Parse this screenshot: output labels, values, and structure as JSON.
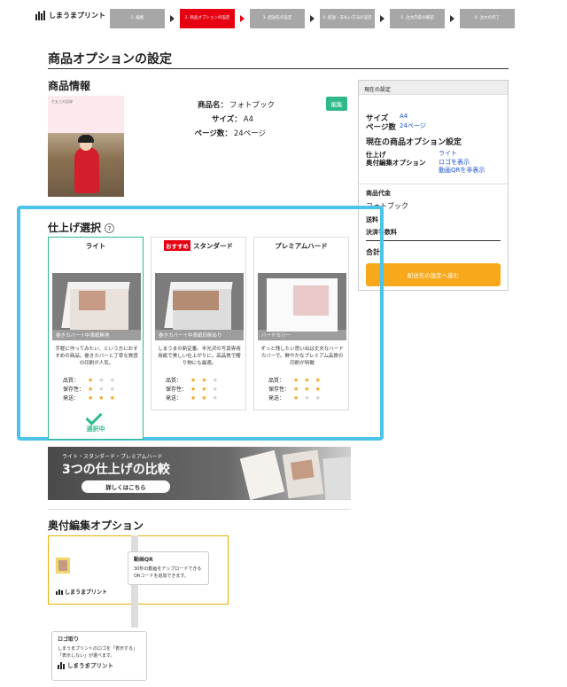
{
  "header": {
    "logo_text": "しまうまプリント",
    "steps": [
      {
        "label": "1. 編集",
        "active": false
      },
      {
        "label": "2. 商品オプションの設定",
        "active": true
      },
      {
        "label": "3. 配送先の設定",
        "active": false
      },
      {
        "label": "4. 配送・支払い方法の設定",
        "active": false
      },
      {
        "label": "5. 注文内容の確認",
        "active": false
      },
      {
        "label": "6. 注文の完了",
        "active": false
      }
    ]
  },
  "page_title": "商品オプションの設定",
  "product_info": {
    "heading": "商品情報",
    "thumb_caption": "七五三の記録",
    "rows": [
      {
        "key": "商品名：",
        "value": "フォトブック"
      },
      {
        "key": "サイズ：",
        "value": "A4"
      },
      {
        "key": "ページ数：",
        "value": "24ページ"
      }
    ],
    "edit_label": "編集"
  },
  "summary": {
    "header": "現在の設定",
    "size_key": "サイズ",
    "size_value": "A4",
    "pages_key": "ページ数",
    "pages_value": "24ページ",
    "options_heading": "現在の商品オプション設定",
    "finish_key": "仕上げ",
    "finish_value": "ライト",
    "colophon_key": "奥付編集オプション",
    "colophon_value1": "ロゴを表示",
    "colophon_value2": "動画QRを非表示",
    "price_heading": "商品代金",
    "price_item": "フォトブック",
    "shipping": "送料",
    "fee": "決済手数料",
    "total": "合計",
    "next_button": "配送先の設定へ進む"
  },
  "finish": {
    "heading": "仕上げ選択",
    "help": "?",
    "rating_labels": [
      "品質：",
      "保存性：",
      "発送："
    ],
    "cards": [
      {
        "title": "ライト",
        "badge": "",
        "caption": "巻きカバー＋中表紙無地",
        "desc": "手軽に作ってみたい、という方におすすめの商品。巻きカバーと丁寧な質感の印刷が人気。",
        "ratings": [
          1,
          1,
          3
        ],
        "selected": true,
        "selected_label": "選択中"
      },
      {
        "title": "スタンダード",
        "badge": "おすすめ",
        "caption": "巻きカバー＋中表紙印刷あり",
        "desc": "しまうまの新定番。半光沢の写真専用用紙で美しい仕上がりに。高品質で贈り物にも最適。",
        "ratings": [
          2,
          2,
          2
        ],
        "selected": false,
        "selected_label": ""
      },
      {
        "title": "プレミアムハード",
        "badge": "",
        "caption": "ハードカバー",
        "desc": "ずっと残したい思い出は丈夫なハードカバーで。鮮やかなプレミアム品質の印刷が特徴",
        "ratings": [
          3,
          3,
          1
        ],
        "selected": false,
        "selected_label": ""
      }
    ]
  },
  "compare_banner": {
    "sub": "ライト・スタンダード・プレミアムハード",
    "title": "3つの仕上げの比較",
    "link": "詳しくはこちら"
  },
  "colophon": {
    "heading": "奥付編集オプション",
    "tip_qr_title": "動画QR",
    "tip_qr_text": "30秒の動画をアップロードできるQRコードを追加できます。",
    "tip_logo_title": "ロゴ取り",
    "tip_logo_text": "しまうまプリントのロゴを「表示する」「表示しない」が選べます。",
    "brand": "しまうまプリント"
  }
}
